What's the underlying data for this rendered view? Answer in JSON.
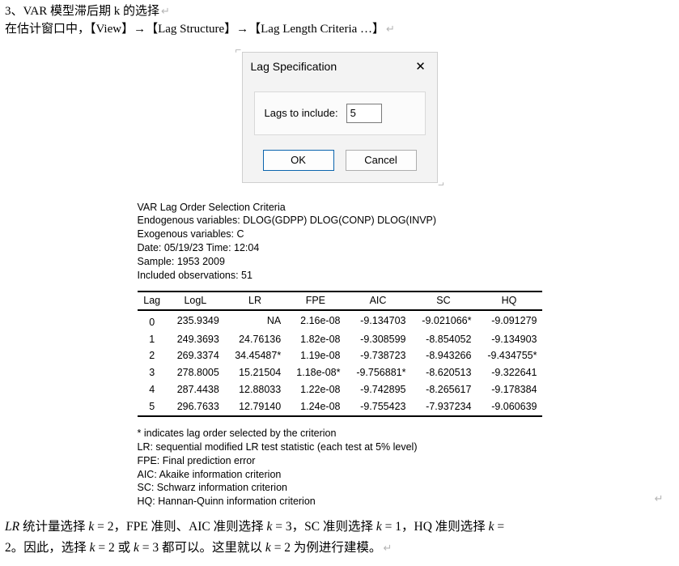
{
  "heading": "3、VAR 模型滞后期 k 的选择",
  "line2_a": "在估计窗口中，【View】→【Lag Structure】→【Lag Length Criteria …】",
  "return_glyph": "↵",
  "anchor_glyph": "⌐",
  "anchor_glyph_br": "⌐",
  "dialog": {
    "title": "Lag Specification",
    "close": "✕",
    "label": "Lags to include:",
    "value": "5",
    "ok": "OK",
    "cancel": "Cancel"
  },
  "output": {
    "hdr1": "VAR Lag Order Selection Criteria",
    "hdr2": "Endogenous variables: DLOG(GDPP) DLOG(CONP) DLOG(INVP)",
    "hdr3": "Exogenous variables: C",
    "hdr4": "Date: 05/19/23   Time: 12:04",
    "hdr5": "Sample: 1953 2009",
    "hdr6": "Included observations: 51",
    "cols": [
      "Lag",
      "LogL",
      "LR",
      "FPE",
      "AIC",
      "SC",
      "HQ"
    ],
    "rows": [
      [
        "0",
        "235.9349",
        "NA",
        "2.16e-08",
        "-9.134703",
        "-9.021066*",
        "-9.091279"
      ],
      [
        "1",
        "249.3693",
        "24.76136",
        "1.82e-08",
        "-9.308599",
        "-8.854052",
        "-9.134903"
      ],
      [
        "2",
        "269.3374",
        "34.45487*",
        "1.19e-08",
        "-9.738723",
        "-8.943266",
        "-9.434755*"
      ],
      [
        "3",
        "278.8005",
        "15.21504",
        "1.18e-08*",
        "-9.756881*",
        "-8.620513",
        "-9.322641"
      ],
      [
        "4",
        "287.4438",
        "12.88033",
        "1.22e-08",
        "-9.742895",
        "-8.265617",
        "-9.178384"
      ],
      [
        "5",
        "296.7633",
        "12.79140",
        "1.24e-08",
        "-9.755423",
        "-7.937234",
        "-9.060639"
      ]
    ],
    "n1": "* indicates lag order selected by the criterion",
    "n2": "LR: sequential modified LR test statistic (each test at 5% level)",
    "n3": "FPE: Final prediction error",
    "n4": "AIC: Akaike information criterion",
    "n5": "SC: Schwarz information criterion",
    "n6": "HQ: Hannan-Quinn information criterion"
  },
  "para1_a": "LR",
  "para1_b": " 统计量选择 ",
  "para1_c": "k",
  "para1_d": " = 2，FPE 准则、AIC 准则选择 ",
  "para1_e": "k",
  "para1_f": " = 3，SC 准则选择 ",
  "para1_g": "k",
  "para1_h": " = 1，HQ 准则选择 ",
  "para1_i": "k",
  "para1_j": " =",
  "para2_a": "2。因此，选择 ",
  "para2_b": "k",
  "para2_c": " = 2 或 ",
  "para2_d": "k",
  "para2_e": " = 3  都可以。这里就以 ",
  "para2_f": "k",
  "para2_g": " = 2 为例进行建模。"
}
